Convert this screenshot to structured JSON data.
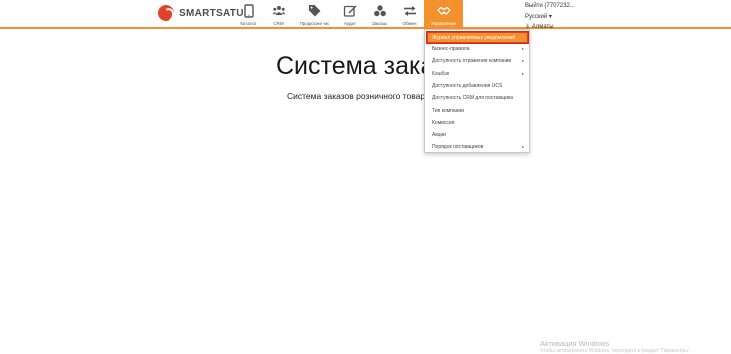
{
  "brand": {
    "name": "SMARTSATU"
  },
  "nav": [
    {
      "label": "Каталог",
      "icon": "tablet-icon"
    },
    {
      "label": "CRM",
      "icon": "people-icon"
    },
    {
      "label": "Продюсинг-мс",
      "icon": "tags-icon"
    },
    {
      "label": "Аудит",
      "icon": "edit-icon"
    },
    {
      "label": "Заказы",
      "icon": "boxes-icon"
    },
    {
      "label": "Обмен",
      "icon": "exchange-icon"
    },
    {
      "label": "Управление",
      "icon": "handshake-icon",
      "active": true
    }
  ],
  "user": {
    "logout": "Выйти (7707232...",
    "language": "Русский ▾",
    "city": "⇓ Алматы"
  },
  "dropdown": {
    "highlighted": "Журнал управляемых уведомлений",
    "items": [
      {
        "label": "Бизнес-правила",
        "arrow": true
      },
      {
        "label": "Доступность отражения компании",
        "arrow": true
      },
      {
        "label": "Кэшбэк",
        "arrow": true
      },
      {
        "label": "Доступность добавления UCS",
        "arrow": false
      },
      {
        "label": "Доступность CRM для поставщика",
        "arrow": false
      },
      {
        "label": "Тип компании",
        "arrow": false
      },
      {
        "label": "Комиссия",
        "arrow": false
      },
      {
        "label": "Акции",
        "arrow": false
      },
      {
        "label": "Порядок поставщиков",
        "arrow": true
      }
    ]
  },
  "hero": {
    "title": "Система заказ",
    "subtitle": "Система заказов розничного товарооб"
  },
  "watermark": {
    "title": "Активация Windows",
    "subtitle": "Чтобы активировать Windows, перейдите в раздел \"Параметры\"."
  },
  "colors": {
    "accent": "#f3912f",
    "highlight_border": "#e53d1f"
  }
}
